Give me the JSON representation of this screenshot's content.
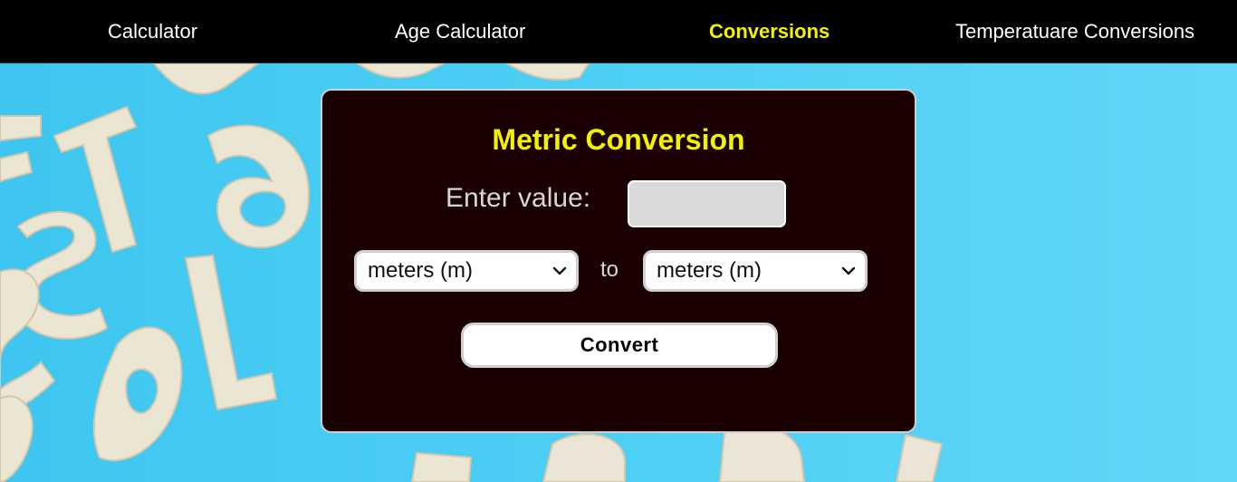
{
  "nav": {
    "items": [
      {
        "label": "Calculator",
        "active": false
      },
      {
        "label": "Age Calculator",
        "active": false
      },
      {
        "label": "Conversions",
        "active": true
      },
      {
        "label": "Temperatuare Conversions",
        "active": false
      }
    ]
  },
  "converter": {
    "title": "Metric Conversion",
    "enter_label": "Enter value:",
    "value": "",
    "from_unit": "meters (m)",
    "to_label": "to",
    "to_unit": "meters (m)",
    "convert_label": "Convert"
  },
  "colors": {
    "nav_bg": "#000000",
    "active_nav": "#f2f200",
    "card_bg": "#1a0000",
    "title": "#f2f200",
    "background": "#45cbf2"
  }
}
